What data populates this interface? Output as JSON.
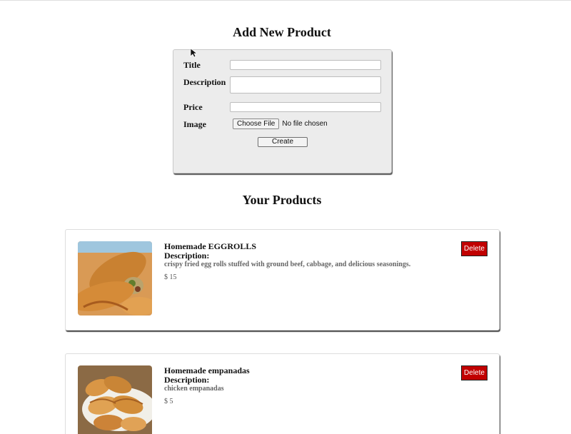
{
  "form": {
    "title": "Add New Product",
    "labels": {
      "title": "Title",
      "description": "Description",
      "price": "Price",
      "image": "Image"
    },
    "values": {
      "title": "",
      "description": "",
      "price": ""
    },
    "file_button": "Choose File",
    "file_status": "No file chosen",
    "create_button": "Create"
  },
  "products_section": {
    "title": "Your Products",
    "items": [
      {
        "name": "Homemade EGGROLLS",
        "description_label": "Description:",
        "description": "crispy fried egg rolls stuffed with ground beef, cabbage, and delicious seasonings.",
        "price": "$ 15",
        "delete_label": "Delete",
        "image_icon": "eggroll-photo"
      },
      {
        "name": "Homemade empanadas",
        "description_label": "Description:",
        "description": "chicken empanadas",
        "price": "$ 5",
        "delete_label": "Delete",
        "image_icon": "empanada-photo"
      }
    ]
  },
  "colors": {
    "form_background": "#ececec",
    "delete_button": "#c10000",
    "delete_text": "#ffffff"
  }
}
